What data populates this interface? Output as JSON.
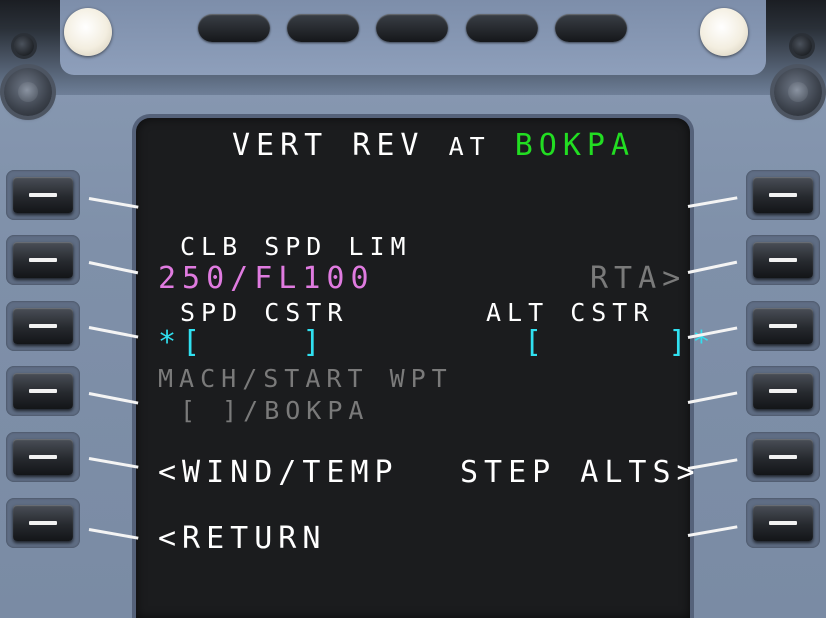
{
  "title": {
    "prefix": "VERT REV",
    "at": "AT",
    "waypoint": "BOKPA"
  },
  "rows": {
    "clb_spd_lim_label": "CLB SPD LIM",
    "clb_spd_lim_value": "250/FL100",
    "rta": "RTA>",
    "spd_cstr_label": "SPD CSTR",
    "spd_cstr_field": "*[    ]",
    "alt_cstr_label": "ALT CSTR",
    "alt_cstr_field": "[     ]*",
    "mach_start_label": "MACH/START WPT",
    "mach_start_field": "[ ]/BOKPA",
    "wind_temp": "<WIND/TEMP",
    "step_alts": "STEP ALTS>",
    "return": "<RETURN"
  },
  "colors": {
    "title_waypoint": "#22dd22",
    "clb_spd_lim_value": "#e07be0",
    "cstr_fields": "#30e0f0",
    "disabled": "#7a7a7a"
  },
  "icons": {
    "annunciator_lamps": [
      "brightness-lamp-left",
      "brightness-lamp-right"
    ],
    "knobs": [
      "knob-left",
      "knob-right"
    ]
  }
}
